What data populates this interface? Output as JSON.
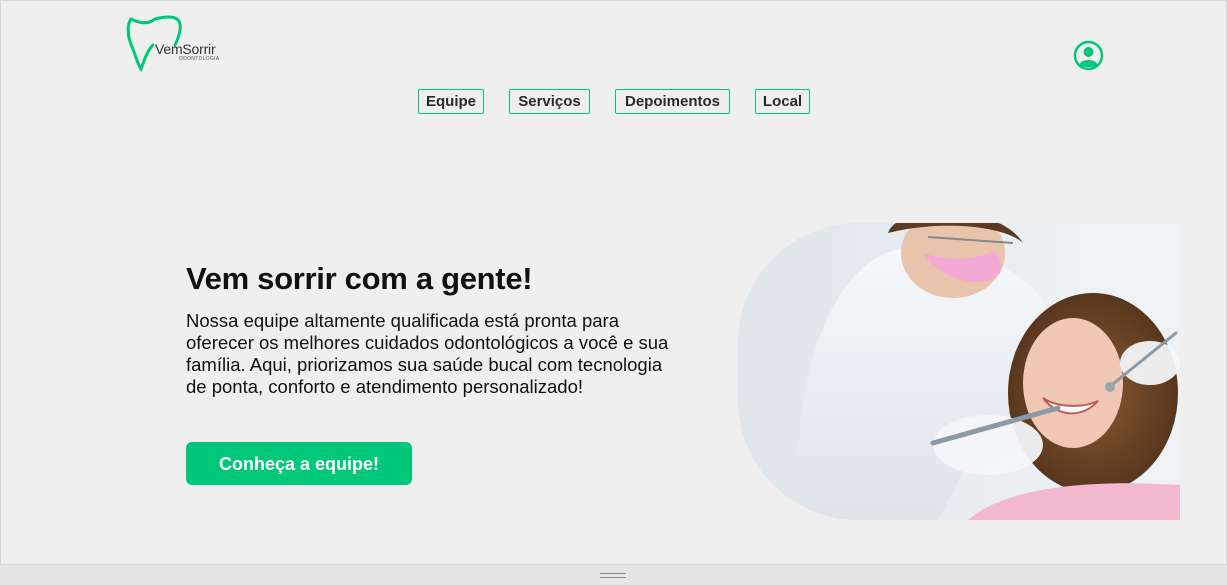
{
  "brand": {
    "name": "VemSorrir",
    "subtitle": "ODONTOLOGIA"
  },
  "nav": {
    "items": [
      {
        "label": "Equipe"
      },
      {
        "label": "Serviços"
      },
      {
        "label": "Depoimentos"
      },
      {
        "label": "Local"
      }
    ]
  },
  "hero": {
    "title": "Vem sorrir com a gente!",
    "text": "Nossa equipe altamente qualificada está pronta para oferecer os melhores cuidados odontológicos a você e sua família. Aqui, priorizamos sua saúde bucal com tecnologia de ponta, conforto e atendimento personalizado!",
    "cta_label": "Conheça a equipe!"
  },
  "colors": {
    "accent": "#00c878",
    "background": "#efefef",
    "text": "#111111"
  },
  "icons": {
    "logo": "tooth-logo",
    "profile": "user-circle-icon"
  }
}
